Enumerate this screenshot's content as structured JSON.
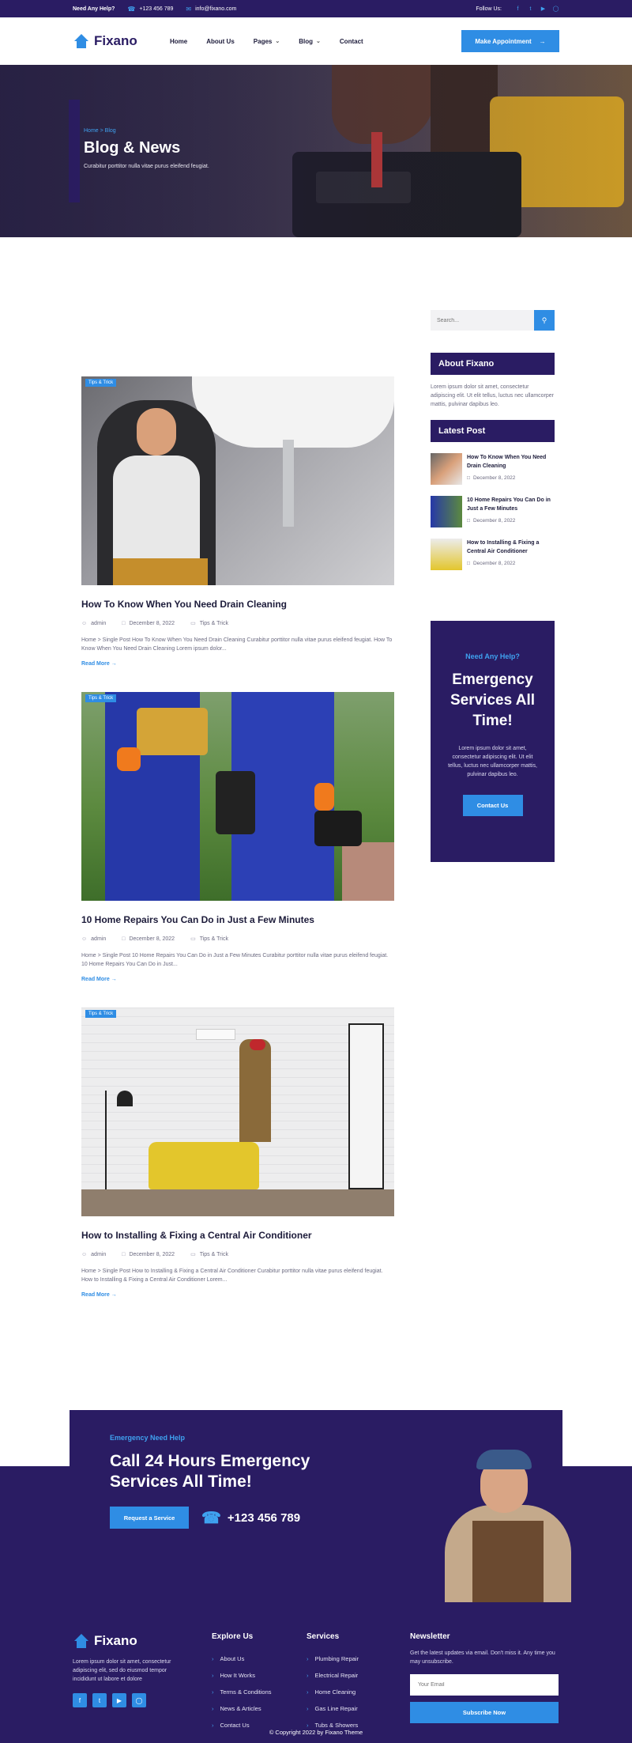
{
  "topbar": {
    "need_help": "Need Any Help?",
    "phone": "+123 456 789",
    "email": "info@fixano.com",
    "follow": "Follow Us:"
  },
  "brand": {
    "name": "Fixano"
  },
  "nav": {
    "items": [
      {
        "label": "Home",
        "dropdown": false
      },
      {
        "label": "About Us",
        "dropdown": false
      },
      {
        "label": "Pages",
        "dropdown": true
      },
      {
        "label": "Blog",
        "dropdown": true
      },
      {
        "label": "Contact",
        "dropdown": false
      }
    ],
    "cta": "Make Appointment"
  },
  "hero": {
    "breadcrumb_home": "Home",
    "breadcrumb_sep": " > ",
    "breadcrumb_current": "Blog",
    "title": "Blog & News",
    "subtitle": "Curabitur porttitor nulla vitae purus eleifend feugiat."
  },
  "posts": [
    {
      "tag": "Tips & Trick",
      "title": "How To Know When You Need Drain Cleaning",
      "author": "admin",
      "date": "December 8, 2022",
      "category": "Tips & Trick",
      "excerpt": "Home > Single Post How To Know When You Need Drain Cleaning Curabitur porttitor nulla vitae purus eleifend feugiat. How To Know When You Need Drain Cleaning Lorem ipsum dolor...",
      "readmore": "Read More →"
    },
    {
      "tag": "Tips & Trick",
      "title": "10 Home Repairs You Can Do in Just a Few Minutes",
      "author": "admin",
      "date": "December 8, 2022",
      "category": "Tips & Trick",
      "excerpt": "Home > Single Post 10 Home Repairs You Can Do in Just a Few Minutes Curabitur porttitor nulla vitae purus eleifend feugiat. 10 Home Repairs You Can Do in Just...",
      "readmore": "Read More →"
    },
    {
      "tag": "Tips & Trick",
      "title": "How to Installing & Fixing a Central Air Conditioner",
      "author": "admin",
      "date": "December 8, 2022",
      "category": "Tips & Trick",
      "excerpt": "Home > Single Post How to Installing & Fixing a Central Air Conditioner Curabitur porttitor nulla vitae purus eleifend feugiat. How to Installing & Fixing a Central Air Conditioner Lorem...",
      "readmore": "Read More →"
    }
  ],
  "sidebar": {
    "search_placeholder": "Search...",
    "about_title": "About Fixano",
    "about_text": "Lorem ipsum dolor sit amet, consectetur adipiscing elit. Ut elit tellus, luctus nec ullamcorper mattis, pulvinar dapibus leo.",
    "latest_title": "Latest Post",
    "latest": [
      {
        "title": "How To Know When You Need Drain Cleaning",
        "date": "December 8, 2022"
      },
      {
        "title": "10 Home Repairs You Can Do in Just a Few Minutes",
        "date": "December 8, 2022"
      },
      {
        "title": "How to Installing & Fixing a Central Air Conditioner",
        "date": "December 8, 2022"
      }
    ],
    "emergency": {
      "need": "Need Any Help?",
      "title": "Emergency Services All Time!",
      "text": "Lorem ipsum dolor sit amet, consectetur adipiscing elit. Ut elit tellus, luctus nec ullamcorper mattis, pulvinar dapibus leo.",
      "button": "Contact Us"
    }
  },
  "cta": {
    "label": "Emergency Need Help",
    "title": "Call 24 Hours Emergency Services All Time!",
    "button": "Request a Service",
    "phone": "+123 456 789"
  },
  "footer": {
    "about": "Lorem ipsum dolor sit amet, consectetur adipiscing elit, sed do eiusmod tempor incididunt ut labore et dolore",
    "explore_title": "Explore Us",
    "explore": [
      "About Us",
      "How It Works",
      "Terms & Conditions",
      "News & Articles",
      "Contact Us"
    ],
    "services_title": "Services",
    "services": [
      "Plumbing Repair",
      "Electrical Repair",
      "Home Cleaning",
      "Gas Line Repair",
      "Tubs & Showers"
    ],
    "newsletter_title": "Newsletter",
    "newsletter_text": "Get the latest updates via email. Don't miss it. Any time you may unsubscribe.",
    "email_placeholder": "Your Email",
    "subscribe": "Subscribe Now",
    "copyright": "© Copyright 2022 by Fixano Theme"
  },
  "colors": {
    "primary": "#2a1c63",
    "accent": "#2f8de4"
  },
  "icons": [
    "phone-icon",
    "mail-icon",
    "facebook-icon",
    "twitter-icon",
    "youtube-icon",
    "instagram-icon",
    "search-icon",
    "user-icon",
    "calendar-icon",
    "folder-icon",
    "chevron-right-icon",
    "arrow-right-icon"
  ]
}
